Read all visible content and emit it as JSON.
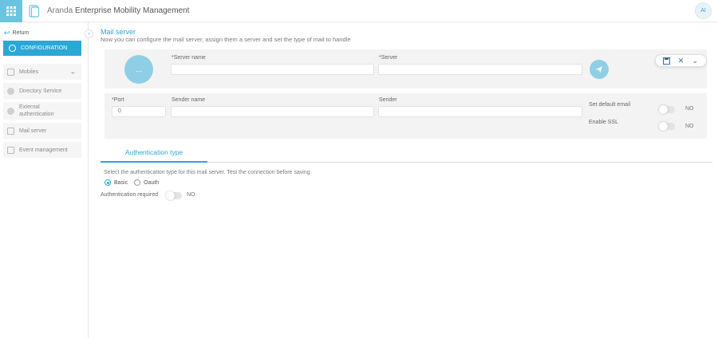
{
  "header": {
    "title_prefix": "Aranda ",
    "title_main": "Enterprise Mobility Management",
    "avatar_initials": "AI"
  },
  "sidebar": {
    "return_label": "Return",
    "config_label": "CONFIGURATION",
    "items": [
      {
        "label": "Mobiles",
        "icon": "mobiles-icon"
      },
      {
        "label": "Directory Service",
        "icon": "directory-icon"
      },
      {
        "label": "External authentication",
        "icon": "fingerprint-icon"
      },
      {
        "label": "Mail server",
        "icon": "mail-icon"
      },
      {
        "label": "Event management",
        "icon": "event-icon"
      }
    ]
  },
  "main": {
    "title": "Mail server",
    "subtitle": "Now you can configure the mail server, assign them a server and set the type of mail to handle",
    "avatar_placeholder": "...",
    "server_name_label": "*Server name",
    "server_label": "*Server",
    "port_label": "*Port",
    "port_value": "0",
    "sender_name_label": "Sender name",
    "sender_label": "Sender",
    "default_email_label": "Set default email",
    "default_email_value": "NO",
    "ssl_label": "Enable SSL",
    "ssl_value": "NO"
  },
  "auth": {
    "tab_label": "Authentication type",
    "description": "Select the authentication type for this mail server. Test the connection before saving",
    "options": [
      "Basic",
      "Oauth"
    ],
    "selected": "Basic",
    "required_label": "Authentication required",
    "required_value": "NO"
  },
  "colors": {
    "accent": "#2aa8d6",
    "light_accent": "#8fcfe6",
    "panel": "#f3f3f3"
  }
}
